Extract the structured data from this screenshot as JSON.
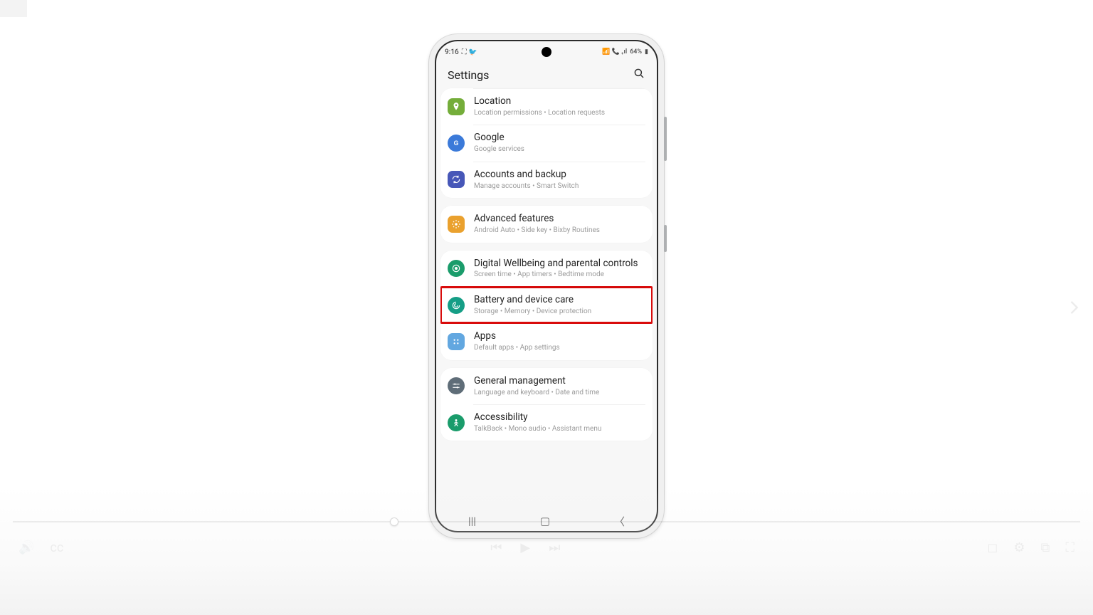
{
  "status": {
    "time": "9:16",
    "left_icons": "⛶ 🐦",
    "right_icons": "📶 📞 ₊ıl",
    "battery": "64%",
    "battery_icon": "▮"
  },
  "header": {
    "title": "Settings"
  },
  "groups": [
    {
      "card_class": "first-card",
      "rows": [
        {
          "name": "settings-row-location",
          "highlight": false,
          "icon": {
            "bg": "#74ad3a",
            "shape": "pin",
            "round": "square"
          },
          "title": "Location",
          "sub": "Location permissions  •  Location requests"
        },
        {
          "name": "settings-row-google",
          "highlight": false,
          "icon": {
            "bg": "#3b7ad9",
            "shape": "g",
            "round": "circle"
          },
          "title": "Google",
          "sub": "Google services"
        },
        {
          "name": "settings-row-accounts",
          "highlight": false,
          "icon": {
            "bg": "#4757b8",
            "shape": "sync",
            "round": "square"
          },
          "title": "Accounts and backup",
          "sub": "Manage accounts  •  Smart Switch"
        }
      ]
    },
    {
      "rows": [
        {
          "name": "settings-row-advanced",
          "highlight": false,
          "icon": {
            "bg": "#eaa12e",
            "shape": "gear",
            "round": "square"
          },
          "title": "Advanced features",
          "sub": "Android Auto  •  Side key  •  Bixby Routines"
        }
      ]
    },
    {
      "rows": [
        {
          "name": "settings-row-wellbeing",
          "highlight": false,
          "icon": {
            "bg": "#1a9c6b",
            "shape": "target",
            "round": "circle"
          },
          "title": "Digital Wellbeing and parental controls",
          "sub": "Screen time  •  App timers  •  Bedtime mode"
        },
        {
          "name": "settings-row-battery",
          "highlight": true,
          "icon": {
            "bg": "#159e86",
            "shape": "swirl",
            "round": "circle"
          },
          "title": "Battery and device care",
          "sub": "Storage  •  Memory  •  Device protection"
        },
        {
          "name": "settings-row-apps",
          "highlight": false,
          "icon": {
            "bg": "#62a7e0",
            "shape": "grid",
            "round": "square"
          },
          "title": "Apps",
          "sub": "Default apps  •  App settings"
        }
      ]
    },
    {
      "rows": [
        {
          "name": "settings-row-general",
          "highlight": false,
          "icon": {
            "bg": "#5f6d78",
            "shape": "sliders",
            "round": "circle"
          },
          "title": "General management",
          "sub": "Language and keyboard  •  Date and time"
        },
        {
          "name": "settings-row-accessibility",
          "highlight": false,
          "icon": {
            "bg": "#1a9c6b",
            "shape": "person",
            "round": "circle"
          },
          "title": "Accessibility",
          "sub": "TalkBack  •  Mono audio  •  Assistant menu"
        }
      ]
    }
  ],
  "nav": {
    "recents": "|||",
    "home": "▢",
    "back": "〈"
  }
}
